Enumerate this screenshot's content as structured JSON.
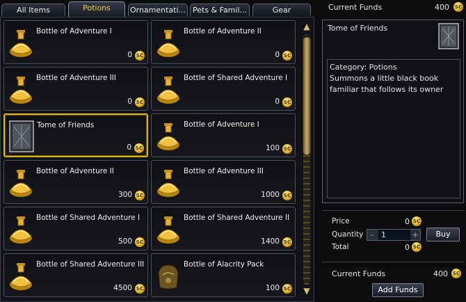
{
  "tabs": [
    {
      "label": "All Items",
      "active": false
    },
    {
      "label": "Potions",
      "active": true
    },
    {
      "label": "Ornamentati...",
      "active": false
    },
    {
      "label": "Pets & Famil...",
      "active": false
    },
    {
      "label": "Gear",
      "active": false
    }
  ],
  "items": [
    {
      "name": "Bottle of Adventure I",
      "price": "0",
      "icon": "potion-bottle-icon"
    },
    {
      "name": "Bottle of Adventure II",
      "price": "0",
      "icon": "potion-bottle-icon"
    },
    {
      "name": "Bottle of Adventure III",
      "price": "0",
      "icon": "potion-bottle-icon"
    },
    {
      "name": "Bottle of Shared Adventure I",
      "price": "0",
      "icon": "potion-bottle-icon"
    },
    {
      "name": "Tome of Friends",
      "price": "0",
      "icon": "tome-icon",
      "selected": true
    },
    {
      "name": "Bottle of Adventure I",
      "price": "100",
      "icon": "potion-bottle-icon"
    },
    {
      "name": "Bottle of Adventure II",
      "price": "300",
      "icon": "potion-bottle-icon"
    },
    {
      "name": "Bottle of Adventure III",
      "price": "1000",
      "icon": "potion-bottle-icon"
    },
    {
      "name": "Bottle of Shared Adventure I",
      "price": "500",
      "icon": "potion-bottle-icon"
    },
    {
      "name": "Bottle of Shared Adventure II",
      "price": "1400",
      "icon": "potion-bottle-icon"
    },
    {
      "name": "Bottle of Shared Adventure III",
      "price": "4500",
      "icon": "potion-bottle-icon"
    },
    {
      "name": "Bottle of Alacrity Pack",
      "price": "100",
      "icon": "alacrity-pack-icon"
    }
  ],
  "coin_label": "SC",
  "header_funds": {
    "label": "Current Funds",
    "value": "400"
  },
  "detail": {
    "title": "Tome of Friends",
    "category": "Category: Potions",
    "description": "Summons a little black book familiar that follows its owner"
  },
  "purchase": {
    "price_label": "Price",
    "price_value": "0",
    "quantity_label": "Quantity",
    "quantity_value": "1",
    "minus": "-",
    "plus": "+",
    "total_label": "Total",
    "total_value": "0",
    "buy_label": "Buy"
  },
  "funds": {
    "label": "Current Funds",
    "value": "400",
    "add_label": "Add Funds"
  },
  "colors": {
    "selected_border": "#d8b417",
    "active_tab_text": "#f0d23a",
    "panel_bg": "#101116"
  }
}
